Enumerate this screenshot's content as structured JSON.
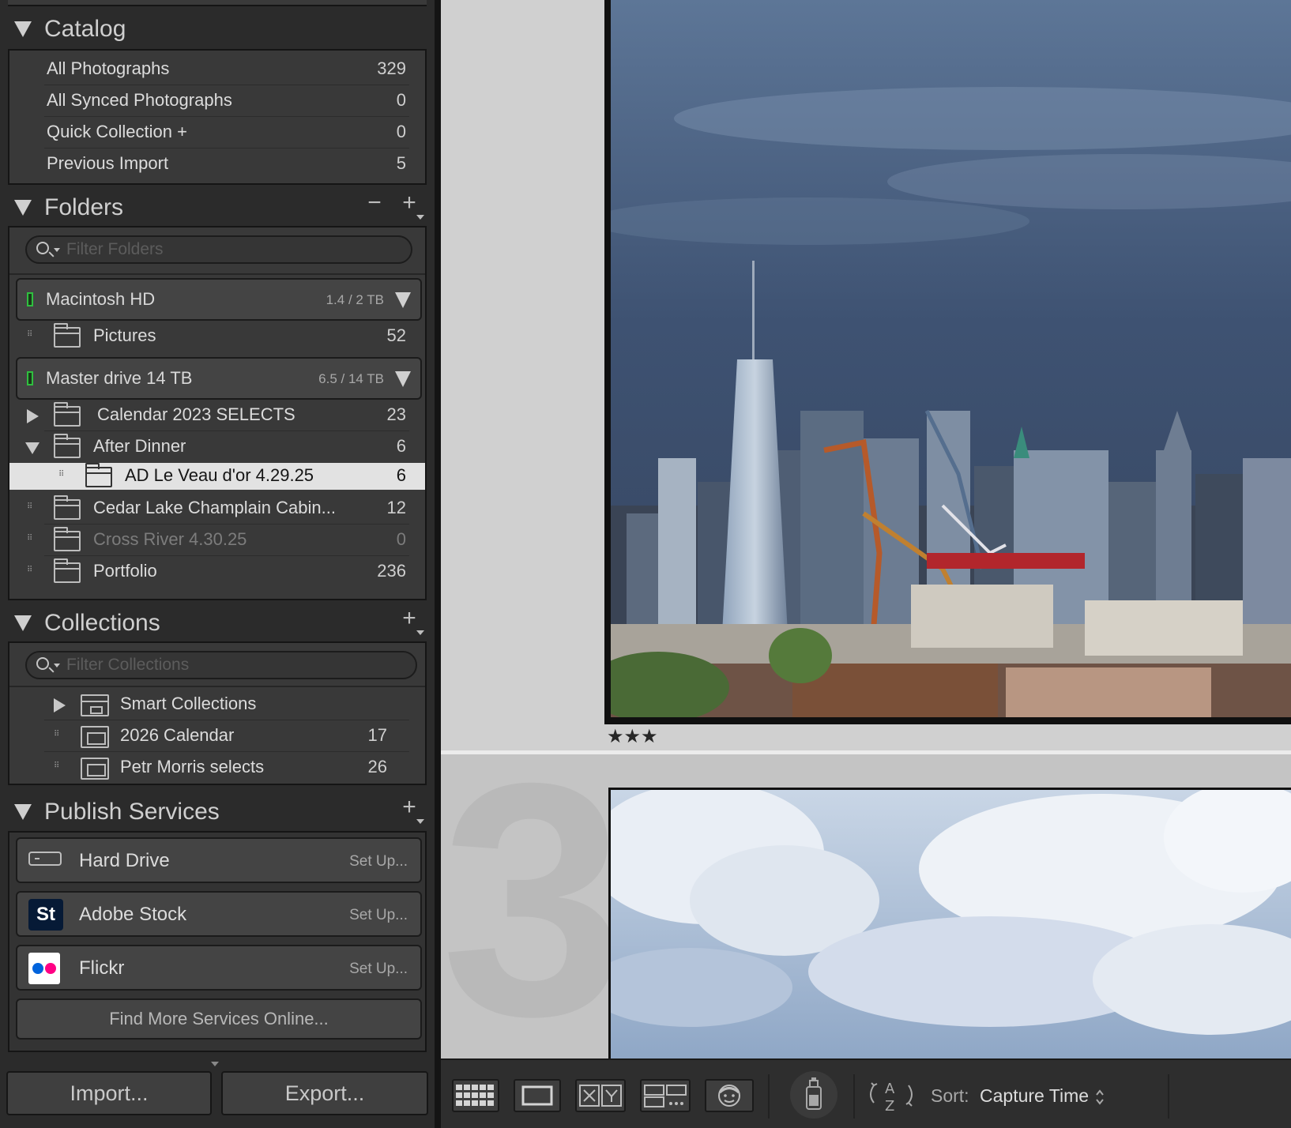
{
  "catalog": {
    "title": "Catalog",
    "items": [
      {
        "label": "All Photographs",
        "count": "329"
      },
      {
        "label": "All Synced Photographs",
        "count": "0"
      },
      {
        "label": "Quick Collection +",
        "count": "0"
      },
      {
        "label": "Previous Import",
        "count": "5"
      }
    ]
  },
  "folders": {
    "title": "Folders",
    "filter_placeholder": "Filter Folders",
    "volumes": [
      {
        "name": "Macintosh HD",
        "size": "1.4 / 2 TB"
      },
      {
        "name": "Master drive 14 TB",
        "size": "6.5 / 14 TB"
      }
    ],
    "items": [
      {
        "label": "Pictures",
        "count": "52"
      },
      {
        "label": "Calendar 2023 SELECTS",
        "count": "23"
      },
      {
        "label": "After Dinner",
        "count": "6"
      },
      {
        "label": "AD Le Veau d'or 4.29.25",
        "count": "6"
      },
      {
        "label": "Cedar Lake Champlain Cabin...",
        "count": "12"
      },
      {
        "label": "Cross River 4.30.25",
        "count": "0"
      },
      {
        "label": "Portfolio",
        "count": "236"
      }
    ]
  },
  "collections": {
    "title": "Collections",
    "filter_placeholder": "Filter Collections",
    "items": [
      {
        "label": "Smart Collections",
        "count": ""
      },
      {
        "label": "2026 Calendar",
        "count": "17"
      },
      {
        "label": "Petr Morris selects",
        "count": "26"
      }
    ]
  },
  "publish": {
    "title": "Publish Services",
    "services": [
      {
        "name": "Hard Drive",
        "action": "Set Up..."
      },
      {
        "name": "Adobe Stock",
        "action": "Set Up...",
        "icon_text": "St"
      },
      {
        "name": "Flickr",
        "action": "Set Up..."
      }
    ],
    "find_more": "Find More Services Online..."
  },
  "buttons": {
    "import": "Import...",
    "export": "Export..."
  },
  "grid": {
    "cell_number": "3",
    "top_rating": "★★★"
  },
  "toolbar": {
    "sort_label": "Sort:",
    "sort_value": "Capture Time"
  },
  "colors": {
    "panel_bg": "#2b2b2b",
    "selected_row": "#e2e2e2",
    "drive_led": "#2fbf3f",
    "adobe_stock_bg": "#061a36",
    "flickr_blue": "#0063dc",
    "flickr_pink": "#ff0084"
  }
}
